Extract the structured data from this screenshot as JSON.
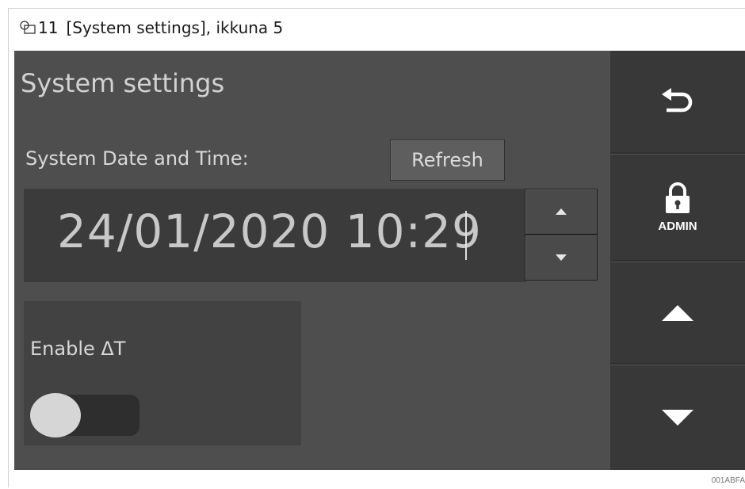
{
  "caption": {
    "figure_number": "11",
    "text": "[System settings], ikkuna 5"
  },
  "screen": {
    "title": "System settings",
    "datetime_label": "System Date and Time:",
    "refresh_label": "Refresh",
    "datetime_value": "24/01/2020 10:29",
    "enable_delta_t_label": "Enable ΔT",
    "enable_delta_t_on": false
  },
  "sidebar": {
    "back_icon": "back-arrow-icon",
    "lock_icon": "padlock-icon",
    "admin_label": "ADMIN",
    "up_icon": "triangle-up-icon",
    "down_icon": "triangle-down-icon"
  },
  "image_code": "001ABFA"
}
